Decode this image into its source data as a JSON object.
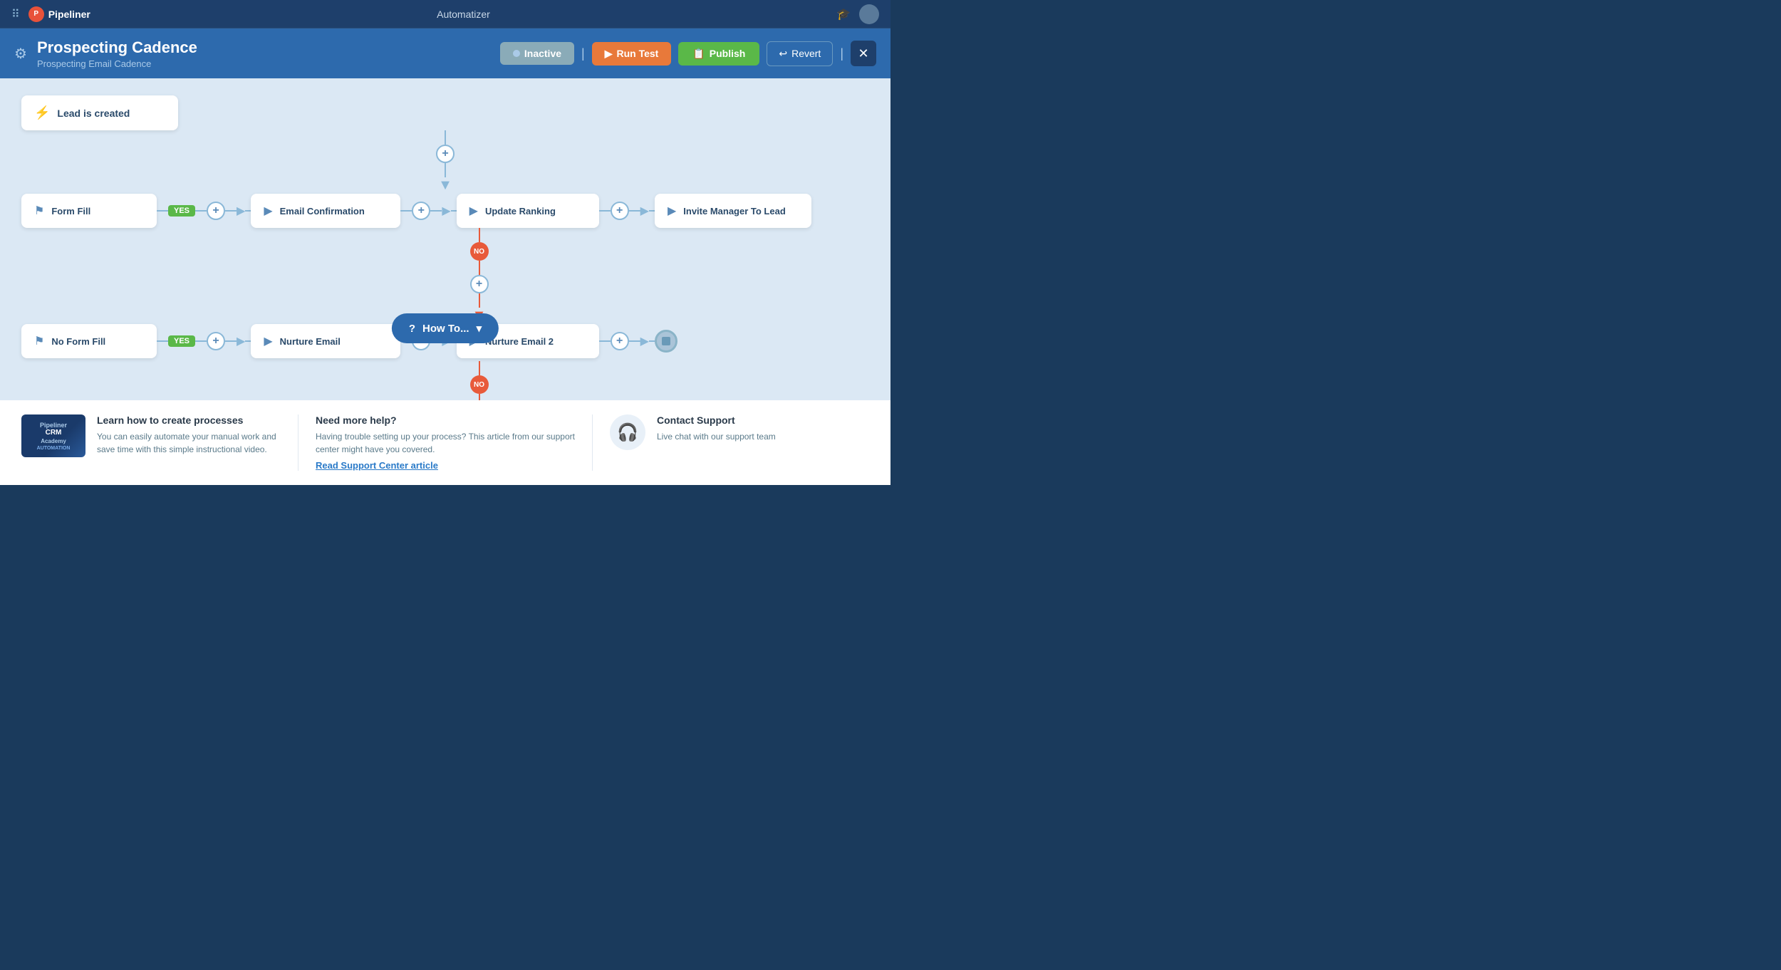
{
  "app": {
    "name": "Pipeliner",
    "page_title": "Automatizer"
  },
  "header": {
    "title": "Prospecting Cadence",
    "subtitle": "Prospecting Email Cadence",
    "btn_inactive": "Inactive",
    "btn_run_test": "Run Test",
    "btn_publish": "Publish",
    "btn_revert": "Revert"
  },
  "flow": {
    "trigger": "Lead is created",
    "yes_path": [
      {
        "label": "Form Fill",
        "type": "filter"
      },
      {
        "label": "Email Confirmation",
        "type": "action"
      },
      {
        "label": "Update Ranking",
        "type": "action"
      },
      {
        "label": "Invite Manager To Lead",
        "type": "action"
      }
    ],
    "no_path": [
      {
        "label": "No Form Fill",
        "type": "filter"
      },
      {
        "label": "Nurture Email",
        "type": "action"
      },
      {
        "label": "Nurture Email 2",
        "type": "action"
      }
    ]
  },
  "how_to_btn": "How To...",
  "help": {
    "section1": {
      "title": "Learn how to create processes",
      "desc": "You can easily automate your manual work and save time with this simple instructional video.",
      "thumb_text": "Pipeliner CRM\nAcademy\nAUTOMATION"
    },
    "section2": {
      "title": "Need more help?",
      "desc": "Having trouble setting up your process? This article from our support center might have you covered.",
      "link": "Read Support Center article"
    },
    "section3": {
      "title": "Contact Support",
      "desc": "Live chat with our support team"
    }
  }
}
